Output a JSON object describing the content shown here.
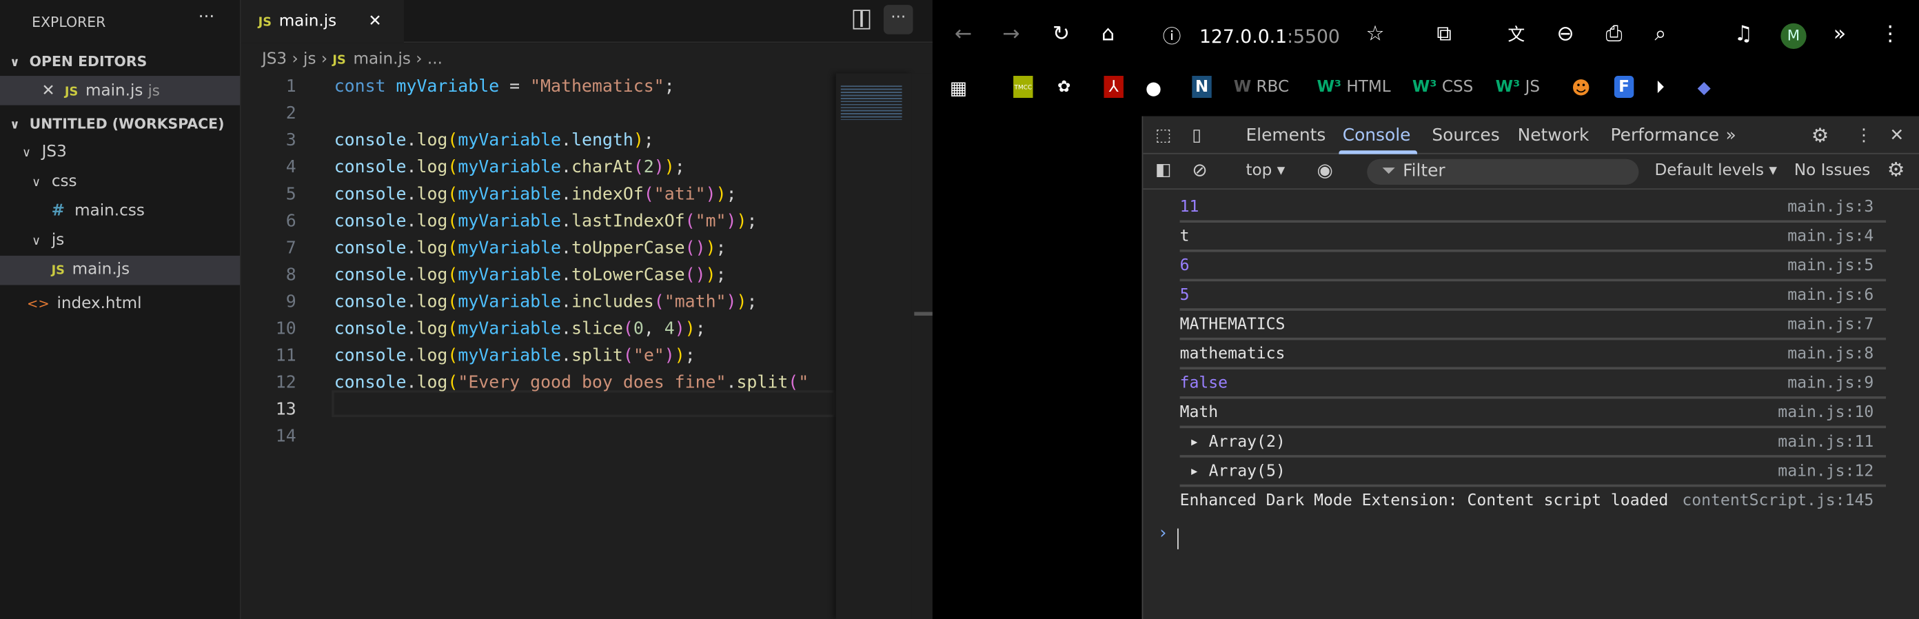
{
  "vscode": {
    "explorer_title": "EXPLORER",
    "more": "···",
    "open_editors": "OPEN EDITORS",
    "open_file": {
      "close": "✕",
      "icon": "JS",
      "name": "main.js",
      "folder": "js"
    },
    "workspace": "UNTITLED (WORKSPACE)",
    "tree": [
      {
        "label": "JS3",
        "type": "folder"
      },
      {
        "label": "css",
        "type": "folder"
      },
      {
        "label": "main.css",
        "type": "css",
        "icon": "#"
      },
      {
        "label": "js",
        "type": "folder"
      },
      {
        "label": "main.js",
        "type": "js",
        "icon": "JS"
      },
      {
        "label": "index.html",
        "type": "html",
        "icon": "<>"
      }
    ],
    "tab": {
      "icon": "JS",
      "label": "main.js",
      "close": "✕"
    },
    "breadcrumb": {
      "a": "JS3",
      "b": "js",
      "c": "main.js",
      "d": "...",
      "sep": "›"
    },
    "current_line": 13,
    "code": [
      [
        [
          "const ",
          "kw"
        ],
        [
          "myVariable",
          "var"
        ],
        [
          " = ",
          "p"
        ],
        [
          "\"Mathematics\"",
          "str"
        ],
        [
          ";",
          "p"
        ]
      ],
      [],
      [
        [
          "console",
          "obj"
        ],
        [
          ".",
          "p"
        ],
        [
          "log",
          "fn"
        ],
        [
          "(",
          "b1"
        ],
        [
          "myVariable",
          "var"
        ],
        [
          ".",
          "p"
        ],
        [
          "length",
          "obj"
        ],
        [
          ")",
          "b1"
        ],
        [
          ";",
          "p"
        ]
      ],
      [
        [
          "console",
          "obj"
        ],
        [
          ".",
          "p"
        ],
        [
          "log",
          "fn"
        ],
        [
          "(",
          "b1"
        ],
        [
          "myVariable",
          "var"
        ],
        [
          ".",
          "p"
        ],
        [
          "charAt",
          "fn"
        ],
        [
          "(",
          "b2"
        ],
        [
          "2",
          "num"
        ],
        [
          ")",
          "b2"
        ],
        [
          ")",
          "b1"
        ],
        [
          ";",
          "p"
        ]
      ],
      [
        [
          "console",
          "obj"
        ],
        [
          ".",
          "p"
        ],
        [
          "log",
          "fn"
        ],
        [
          "(",
          "b1"
        ],
        [
          "myVariable",
          "var"
        ],
        [
          ".",
          "p"
        ],
        [
          "indexOf",
          "fn"
        ],
        [
          "(",
          "b2"
        ],
        [
          "\"ati\"",
          "str"
        ],
        [
          ")",
          "b2"
        ],
        [
          ")",
          "b1"
        ],
        [
          ";",
          "p"
        ]
      ],
      [
        [
          "console",
          "obj"
        ],
        [
          ".",
          "p"
        ],
        [
          "log",
          "fn"
        ],
        [
          "(",
          "b1"
        ],
        [
          "myVariable",
          "var"
        ],
        [
          ".",
          "p"
        ],
        [
          "lastIndexOf",
          "fn"
        ],
        [
          "(",
          "b2"
        ],
        [
          "\"m\"",
          "str"
        ],
        [
          ")",
          "b2"
        ],
        [
          ")",
          "b1"
        ],
        [
          ";",
          "p"
        ]
      ],
      [
        [
          "console",
          "obj"
        ],
        [
          ".",
          "p"
        ],
        [
          "log",
          "fn"
        ],
        [
          "(",
          "b1"
        ],
        [
          "myVariable",
          "var"
        ],
        [
          ".",
          "p"
        ],
        [
          "toUpperCase",
          "fn"
        ],
        [
          "()",
          "b2"
        ],
        [
          ")",
          "b1"
        ],
        [
          ";",
          "p"
        ]
      ],
      [
        [
          "console",
          "obj"
        ],
        [
          ".",
          "p"
        ],
        [
          "log",
          "fn"
        ],
        [
          "(",
          "b1"
        ],
        [
          "myVariable",
          "var"
        ],
        [
          ".",
          "p"
        ],
        [
          "toLowerCase",
          "fn"
        ],
        [
          "()",
          "b2"
        ],
        [
          ")",
          "b1"
        ],
        [
          ";",
          "p"
        ]
      ],
      [
        [
          "console",
          "obj"
        ],
        [
          ".",
          "p"
        ],
        [
          "log",
          "fn"
        ],
        [
          "(",
          "b1"
        ],
        [
          "myVariable",
          "var"
        ],
        [
          ".",
          "p"
        ],
        [
          "includes",
          "fn"
        ],
        [
          "(",
          "b2"
        ],
        [
          "\"math\"",
          "str"
        ],
        [
          ")",
          "b2"
        ],
        [
          ")",
          "b1"
        ],
        [
          ";",
          "p"
        ]
      ],
      [
        [
          "console",
          "obj"
        ],
        [
          ".",
          "p"
        ],
        [
          "log",
          "fn"
        ],
        [
          "(",
          "b1"
        ],
        [
          "myVariable",
          "var"
        ],
        [
          ".",
          "p"
        ],
        [
          "slice",
          "fn"
        ],
        [
          "(",
          "b2"
        ],
        [
          "0",
          "num"
        ],
        [
          ", ",
          "p"
        ],
        [
          "4",
          "num"
        ],
        [
          ")",
          "b2"
        ],
        [
          ")",
          "b1"
        ],
        [
          ";",
          "p"
        ]
      ],
      [
        [
          "console",
          "obj"
        ],
        [
          ".",
          "p"
        ],
        [
          "log",
          "fn"
        ],
        [
          "(",
          "b1"
        ],
        [
          "myVariable",
          "var"
        ],
        [
          ".",
          "p"
        ],
        [
          "split",
          "fn"
        ],
        [
          "(",
          "b2"
        ],
        [
          "\"e\"",
          "str"
        ],
        [
          ")",
          "b2"
        ],
        [
          ")",
          "b1"
        ],
        [
          ";",
          "p"
        ]
      ],
      [
        [
          "console",
          "obj"
        ],
        [
          ".",
          "p"
        ],
        [
          "log",
          "fn"
        ],
        [
          "(",
          "b1"
        ],
        [
          "\"Every good boy does fine\"",
          "str"
        ],
        [
          ".",
          "p"
        ],
        [
          "split",
          "fn"
        ],
        [
          "(",
          "b2"
        ],
        [
          "\" ",
          "str"
        ]
      ],
      [],
      []
    ]
  },
  "browser": {
    "url_host": "127.0.0.1",
    "url_port": ":5500",
    "profile_initial": "M",
    "profile_color": "#2e6b2a",
    "bookmarks": [
      {
        "label": "TMCC"
      },
      {
        "label": "RBC"
      },
      {
        "label": "HTML"
      },
      {
        "label": "CSS"
      },
      {
        "label": "JS"
      }
    ],
    "devtools": {
      "tabs": [
        "Elements",
        "Console",
        "Sources",
        "Network",
        "Performance"
      ],
      "active_tab": "Console",
      "context": "top ▾",
      "filter_placeholder": "Filter",
      "levels": "Default levels ▾",
      "issues": "No Issues",
      "console": [
        {
          "text": "11",
          "src": "main.js:3",
          "kind": "number"
        },
        {
          "text": "t",
          "src": "main.js:4",
          "kind": "string"
        },
        {
          "text": "6",
          "src": "main.js:5",
          "kind": "number"
        },
        {
          "text": "5",
          "src": "main.js:6",
          "kind": "number"
        },
        {
          "text": "MATHEMATICS",
          "src": "main.js:7",
          "kind": "string"
        },
        {
          "text": "mathematics",
          "src": "main.js:8",
          "kind": "string"
        },
        {
          "text": "false",
          "src": "main.js:9",
          "kind": "number"
        },
        {
          "text": "Math",
          "src": "main.js:10",
          "kind": "string"
        },
        {
          "text": "▸ Array(2)",
          "src": "main.js:11",
          "kind": "array"
        },
        {
          "text": "▸ Array(5)",
          "src": "main.js:12",
          "kind": "array"
        },
        {
          "text": "Enhanced Dark Mode Extension: Content script loaded",
          "src": "contentScript.js:145",
          "kind": "string"
        }
      ],
      "prompt": "›"
    }
  }
}
